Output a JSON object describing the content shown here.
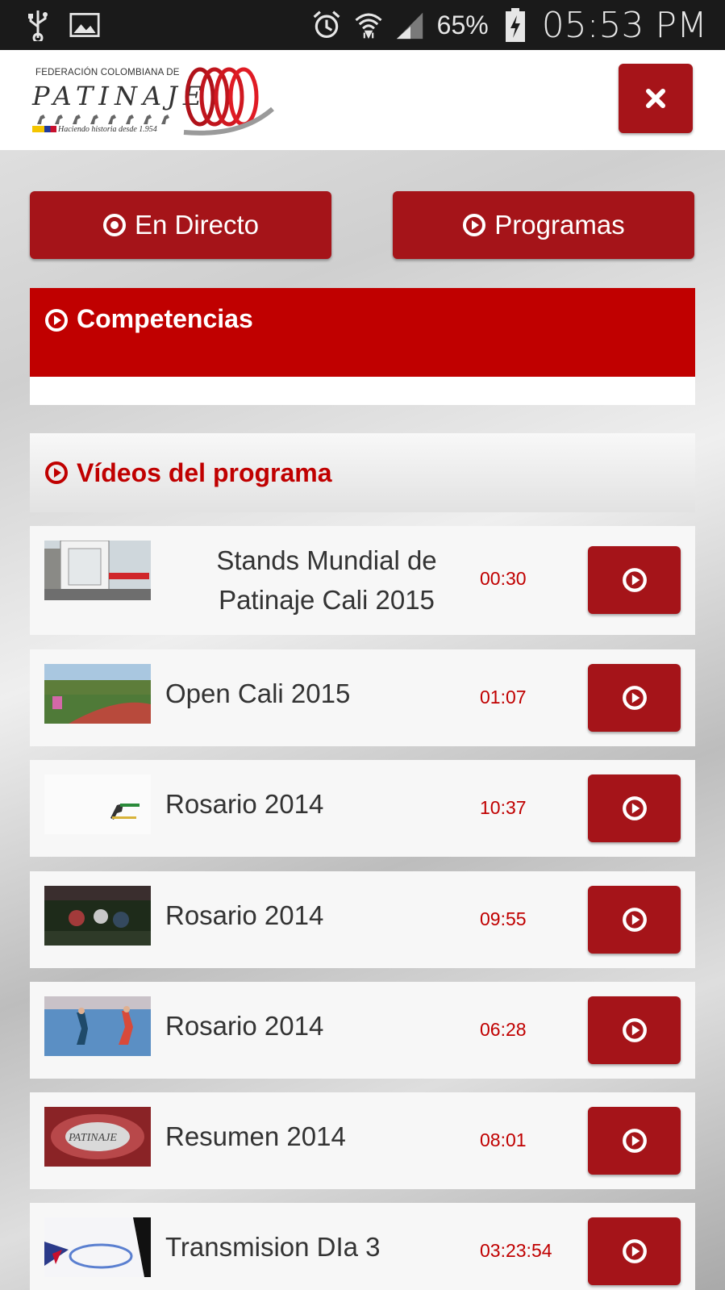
{
  "status_bar": {
    "battery": "65%",
    "time": "05:53 PM",
    "icons": [
      "usb-icon",
      "image-icon",
      "alarm-icon",
      "wifi-icon",
      "signal-icon",
      "battery-icon"
    ]
  },
  "header": {
    "logo_top": "FEDERACIÓN COLOMBIANA DE",
    "logo_main": "PATINAJE",
    "logo_tagline": "Haciendo historia desde 1.954",
    "close_icon": "close-icon"
  },
  "buttons": {
    "live_label": "En Directo",
    "programs_label": "Programas"
  },
  "competencias": {
    "title": "Competencias"
  },
  "videos": {
    "title": "Vídeos del programa",
    "items": [
      {
        "title": "Stands Mundial de Patinaje Cali 2015",
        "duration": "00:30",
        "thumb": "stands"
      },
      {
        "title": "Open Cali 2015",
        "duration": "01:07",
        "thumb": "track"
      },
      {
        "title": "Rosario 2014",
        "duration": "10:37",
        "thumb": "logo"
      },
      {
        "title": "Rosario 2014",
        "duration": "09:55",
        "thumb": "race-dark"
      },
      {
        "title": "Rosario 2014",
        "duration": "06:28",
        "thumb": "race-blue"
      },
      {
        "title": "Resumen 2014",
        "duration": "08:01",
        "thumb": "red-logo"
      },
      {
        "title": "Transmision DIa 3",
        "duration": "03:23:54",
        "thumb": "white-blue"
      }
    ]
  },
  "colors": {
    "brand_red": "#c00000",
    "button_red": "#a51419"
  }
}
